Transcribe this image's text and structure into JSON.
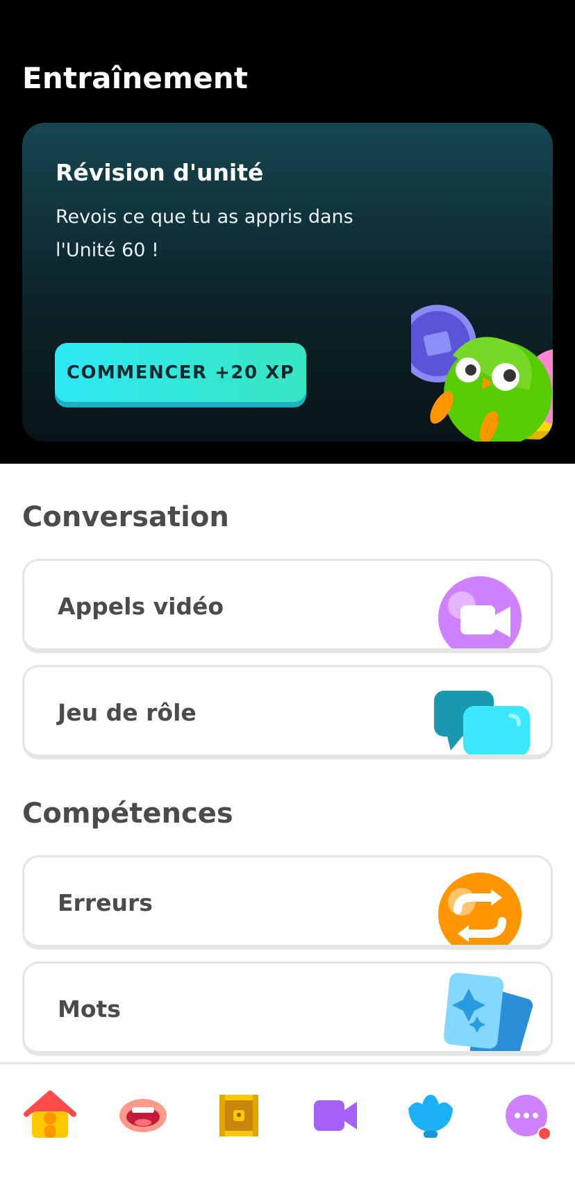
{
  "page": {
    "title": "Entraînement"
  },
  "review_card": {
    "title": "Révision d'unité",
    "description": "Revois ce que tu as appris dans l'Unité 60 !",
    "button_label": "COMMENCER +20 XP"
  },
  "conversation": {
    "title": "Conversation",
    "items": [
      {
        "label": "Appels vidéo",
        "icon": "video-call-icon"
      },
      {
        "label": "Jeu de rôle",
        "icon": "chat-bubbles-icon"
      }
    ]
  },
  "skills": {
    "title": "Compétences",
    "items": [
      {
        "label": "Erreurs",
        "icon": "repeat-icon"
      },
      {
        "label": "Mots",
        "icon": "flashcards-icon"
      }
    ]
  },
  "tabbar": {
    "tabs": [
      {
        "icon": "home-icon",
        "active": true
      },
      {
        "icon": "mouth-icon"
      },
      {
        "icon": "treasure-chest-icon"
      },
      {
        "icon": "video-camera-icon"
      },
      {
        "icon": "shell-icon"
      },
      {
        "icon": "more-icon",
        "badge": true
      }
    ]
  },
  "colors": {
    "accent_cyan": "#2ee8f4",
    "video_purple": "#ce82ff",
    "mistakes_orange": "#ff9600",
    "words_blue": "#84d8ff",
    "badge_red": "#ff4b4b"
  }
}
